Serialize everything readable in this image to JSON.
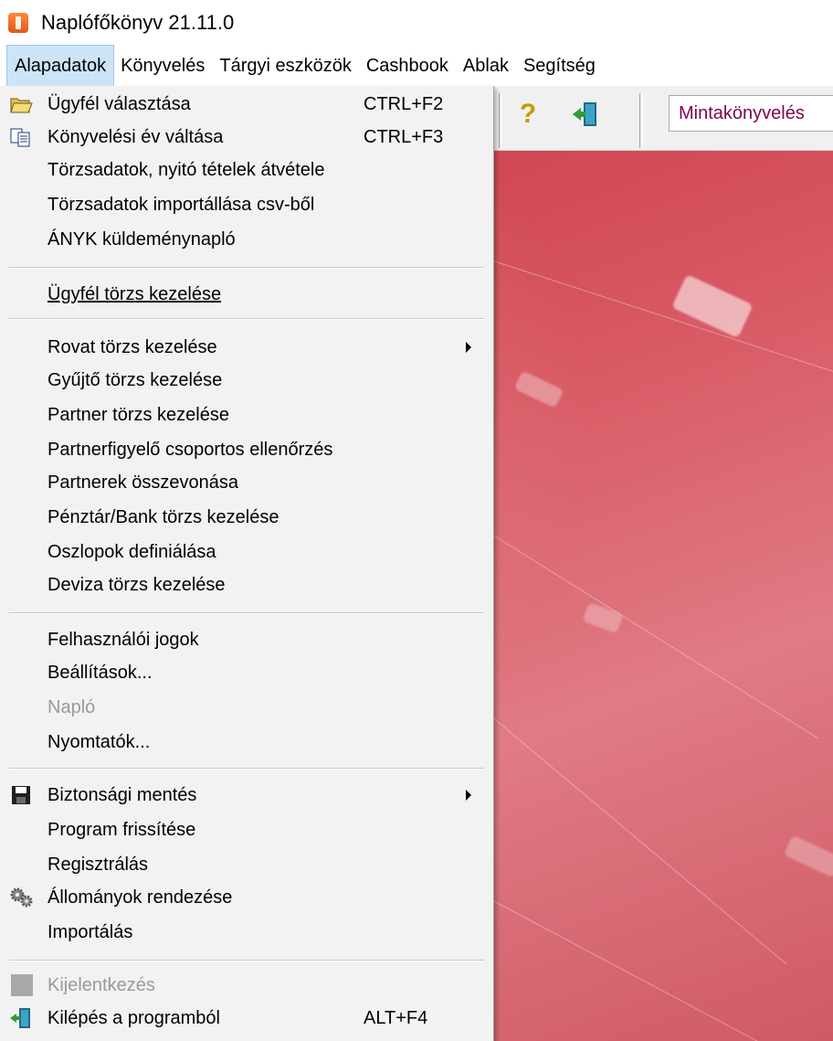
{
  "window": {
    "title": "Naplófőkönyv 21.11.0"
  },
  "menubar": {
    "items": [
      "Alapadatok",
      "Könyvelés",
      "Tárgyi eszközök",
      "Cashbook",
      "Ablak",
      "Segítség"
    ]
  },
  "toolbar": {
    "company_name": "Mintakönyvelés",
    "help_icon": "question-icon",
    "exit_icon": "exit-door-icon"
  },
  "dropdown": {
    "items": [
      {
        "label": "Ügyfél választása",
        "shortcut": "CTRL+F2",
        "icon": "open-folder-icon"
      },
      {
        "label": "Könyvelési év váltása",
        "shortcut": "CTRL+F3",
        "icon": "copy-documents-icon"
      },
      {
        "label": "Törzsadatok, nyitó tételek átvétele"
      },
      {
        "label": "Törzsadatok importállása csv-ből"
      },
      {
        "label": "ÁNYK küldeménynapló"
      },
      {
        "label": "Ügyfél törzs kezelése"
      },
      {
        "label": "Rovat törzs kezelése",
        "submenu": true
      },
      {
        "label": "Gyűjtő törzs kezelése"
      },
      {
        "label": "Partner törzs kezelése"
      },
      {
        "label": "Partnerfigyelő csoportos ellenőrzés"
      },
      {
        "label": "Partnerek összevonása"
      },
      {
        "label": "Pénztár/Bank törzs kezelése"
      },
      {
        "label": "Oszlopok definiálása"
      },
      {
        "label": "Deviza törzs kezelése"
      },
      {
        "label": "Felhasználói jogok"
      },
      {
        "label": "Beállítások..."
      },
      {
        "label": "Napló",
        "disabled": true
      },
      {
        "label": "Nyomtatók..."
      },
      {
        "label": "Biztonsági mentés",
        "submenu": true,
        "icon": "floppy-disk-icon"
      },
      {
        "label": "Program frissítése"
      },
      {
        "label": "Regisztrálás"
      },
      {
        "label": "Állományok rendezése",
        "icon": "gears-icon"
      },
      {
        "label": "Importálás"
      },
      {
        "label": "Kijelentkezés",
        "disabled": true,
        "icon": "logout-grey-icon"
      },
      {
        "label": "Kilépés a programból",
        "shortcut": "ALT+F4",
        "icon": "exit-door-icon"
      }
    ]
  },
  "colors": {
    "menu_highlight": "#cce4f7",
    "workspace_red": "#d85863",
    "company_text": "#7d0552"
  }
}
